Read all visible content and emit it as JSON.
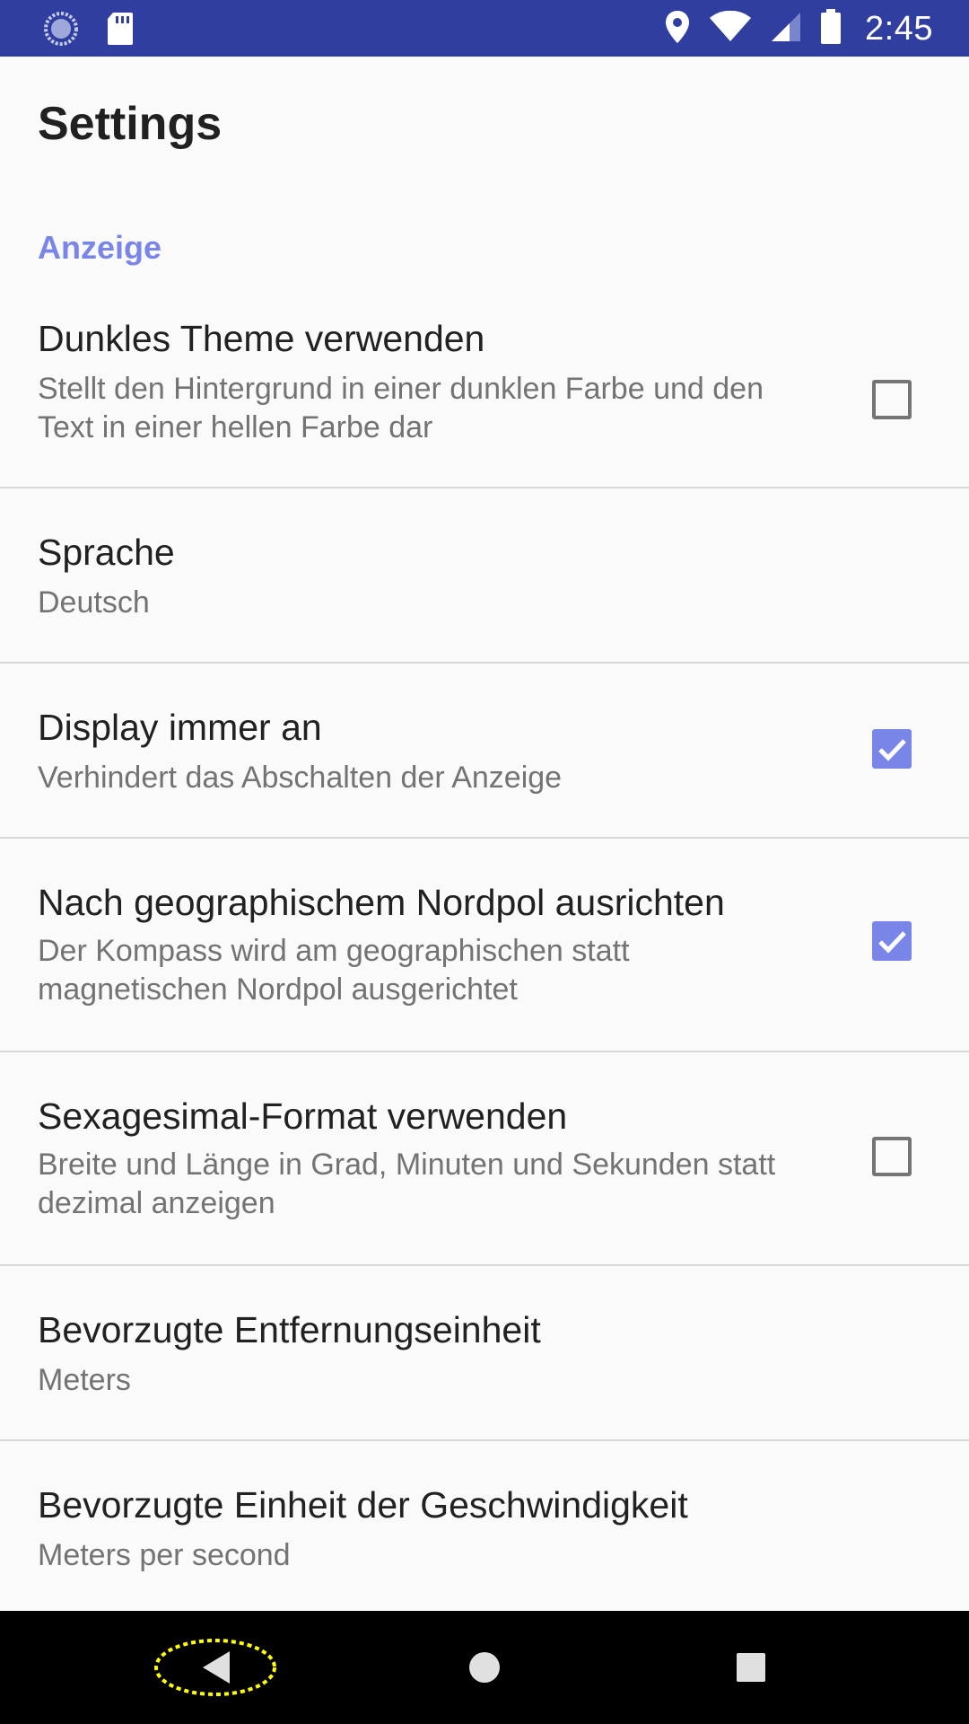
{
  "status_bar": {
    "time": "2:45",
    "left_icons": [
      "sync-icon",
      "sd-card-icon"
    ],
    "right_icons": [
      "location-icon",
      "wifi-icon",
      "signal-icon",
      "battery-icon"
    ],
    "background": "#303f9f"
  },
  "header": {
    "title": "Settings"
  },
  "category": {
    "label": "Anzeige",
    "color": "#7986e8"
  },
  "preferences": [
    {
      "title": "Dunkles Theme verwenden",
      "summary": "Stellt den Hintergrund in einer dunklen Farbe und den Text in einer hellen Farbe dar",
      "checkbox": false
    },
    {
      "title": "Sprache",
      "summary": "Deutsch"
    },
    {
      "title": "Display immer an",
      "summary": "Verhindert das Abschalten der Anzeige",
      "checkbox": true
    },
    {
      "title": "Nach geographischem Nordpol ausrichten",
      "summary": "Der Kompass wird am geographischen statt magnetischen Nordpol ausgerichtet",
      "checkbox": true
    },
    {
      "title": "Sexagesimal-Format verwenden",
      "summary": "Breite und Länge in Grad, Minuten und Sekunden statt dezimal anzeigen",
      "checkbox": false
    },
    {
      "title": "Bevorzugte Entfernungseinheit",
      "summary": "Meters"
    },
    {
      "title": "Bevorzugte Einheit der Geschwindigkeit",
      "summary": "Meters per second"
    }
  ],
  "nav_bar": {
    "buttons": [
      "back-icon",
      "home-icon",
      "recents-icon"
    ]
  }
}
